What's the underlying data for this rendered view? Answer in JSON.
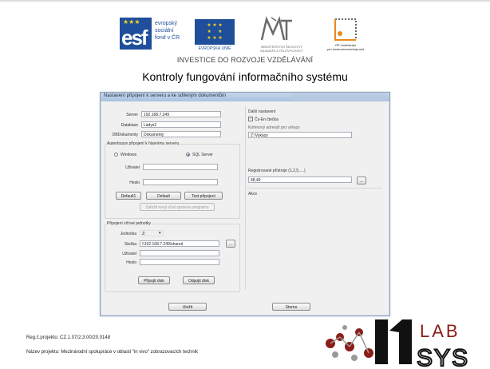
{
  "header": {
    "esf_letters": "esf",
    "esf_line1": "evropský",
    "esf_line2": "sociální",
    "esf_line3": "fond v ČR",
    "eu_label": "EVROPSKÁ UNIE",
    "msmt_line1": "MINISTERSTVO ŠKOLSTVÍ,",
    "msmt_line2": "MLÁDEŽE A TĚLOVÝCHOVY",
    "op_line1": "OP Vzdělávání",
    "op_line2": "pro konkurenceschopnost",
    "investice": "INVESTICE DO ROZVOJE VZDĚLÁVÁNÍ",
    "slide_title": "Kontroly fungování informačního systému"
  },
  "dialog": {
    "title": "Nastavení připojení k serveru a ke sdíleným dokumentům",
    "server_label": "Server",
    "server_value": "192.168.7.249",
    "database_label": "Databáze",
    "database_value": "Ladys2",
    "dbdocs_label": "DBDokumenty",
    "dbdocs_value": "Dokumenty",
    "auth_group": "Autentizace připojení k hlavnímu serveru",
    "windows_label": "Windows",
    "sql_label": "SQL Server",
    "user_label": "Uživatel",
    "user_value": "",
    "password_label": "Heslo",
    "password_value": "",
    "btn_default1": "Default1",
    "btn_default": "Default",
    "btn_test": "Test připojení",
    "btn_create_account": "Založit nový účet správce programu",
    "network_group": "Připojení síťové jednotky",
    "drive_label": "Jednotka",
    "drive_value": "Z:",
    "folder_label": "Složka",
    "folder_value": "\\\\192.168.7.249\\shared",
    "net_user_label": "Uživatel",
    "net_user_value": "",
    "net_password_label": "Heslo",
    "net_password_value": "",
    "btn_connect": "Připojit disk",
    "btn_disconnect": "Odpojit disk",
    "other_group": "Další nastavení",
    "reader_checked": true,
    "reader_label": "Čs-En čtečka",
    "reports_label": "Kořenový adresář pro výkazy",
    "reports_value": "Z:\\Vykazy",
    "multipliers_label": "Registrované přístroje (1,2,5,....)",
    "multipliers_value": "48,49",
    "akce_label": "Akce",
    "btn_browse": "...",
    "btn_save": "Uložit",
    "btn_cancel": "Storno"
  },
  "footer": {
    "reg_line": "Reg.č.projektu: CZ.1.07/2.3.00/20.0148",
    "name_line": "Název projektu: Mezinárodní spolupráce v oblasti \"in vivo\" zobrazovacích technik",
    "logo_lab": "LAB",
    "logo_sys": "SYS"
  }
}
